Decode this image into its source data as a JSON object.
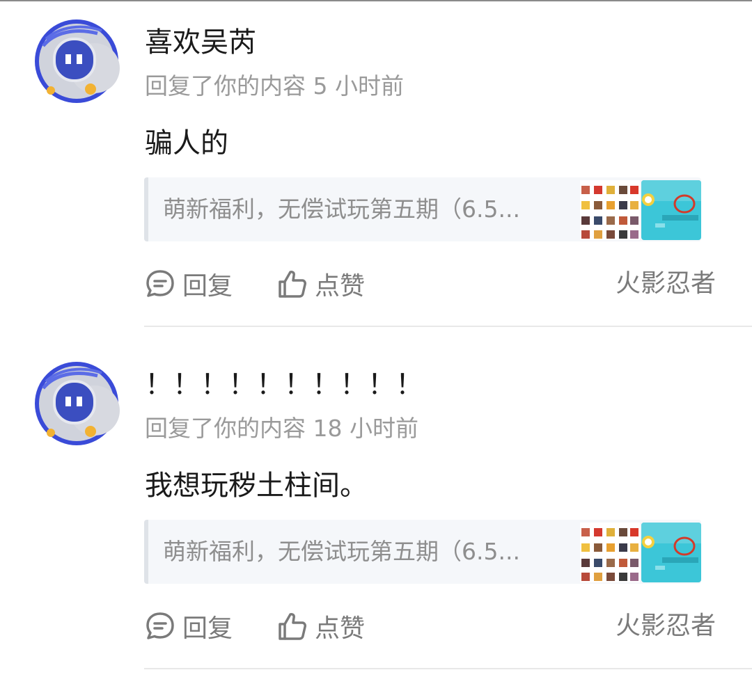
{
  "notifications": [
    {
      "username": "喜欢吴芮",
      "meta": "回复了你的内容 5 小时前",
      "content": "骗人的",
      "quote_text": "萌新福利，无偿试玩第五期（6.5...",
      "reply_label": "回复",
      "like_label": "点赞",
      "game_tag": "火影忍者"
    },
    {
      "username": "！！！！！！！！！！",
      "meta": "回复了你的内容 18 小时前",
      "content": "我想玩秽土柱间。",
      "quote_text": "萌新福利，无偿试玩第五期（6.5...",
      "reply_label": "回复",
      "like_label": "点赞",
      "game_tag": "火影忍者"
    }
  ],
  "colors": {
    "avatar_ring": "#3a4bd8",
    "avatar_face": "#3b4ec0",
    "avatar_dot": "#f2b233",
    "thumb_teal": "#3cc6d8",
    "meta_text": "#9a9a9a",
    "action_text": "#7a7a7a"
  },
  "icons": {
    "reply": "chat-bubble-icon",
    "like": "thumbs-up-icon"
  }
}
